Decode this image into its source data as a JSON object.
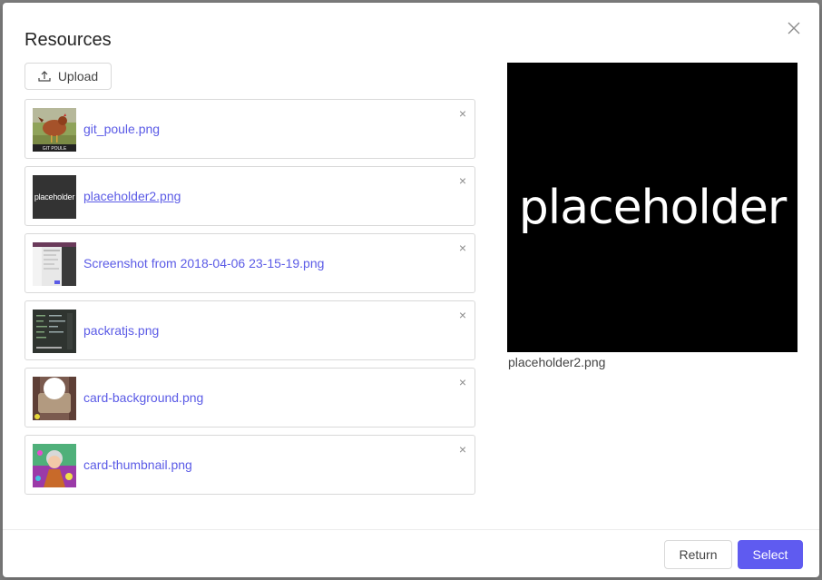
{
  "modal": {
    "title": "Resources",
    "upload_label": "Upload"
  },
  "files": [
    {
      "name": "git_poule.png",
      "remove": "×",
      "thumb_caption": "GIT POULE"
    },
    {
      "name": "placeholder2.png",
      "remove": "×",
      "thumb_text": "placeholder"
    },
    {
      "name": "Screenshot from 2018-04-06 23-15-19.png",
      "remove": "×"
    },
    {
      "name": "packratjs.png",
      "remove": "×"
    },
    {
      "name": "card-background.png",
      "remove": "×"
    },
    {
      "name": "card-thumbnail.png",
      "remove": "×"
    }
  ],
  "preview": {
    "image_text": "placeholder",
    "caption": "placeholder2.png"
  },
  "footer": {
    "return_label": "Return",
    "select_label": "Select"
  },
  "colors": {
    "accent": "#5f5bf0",
    "link": "#5b5be6"
  }
}
